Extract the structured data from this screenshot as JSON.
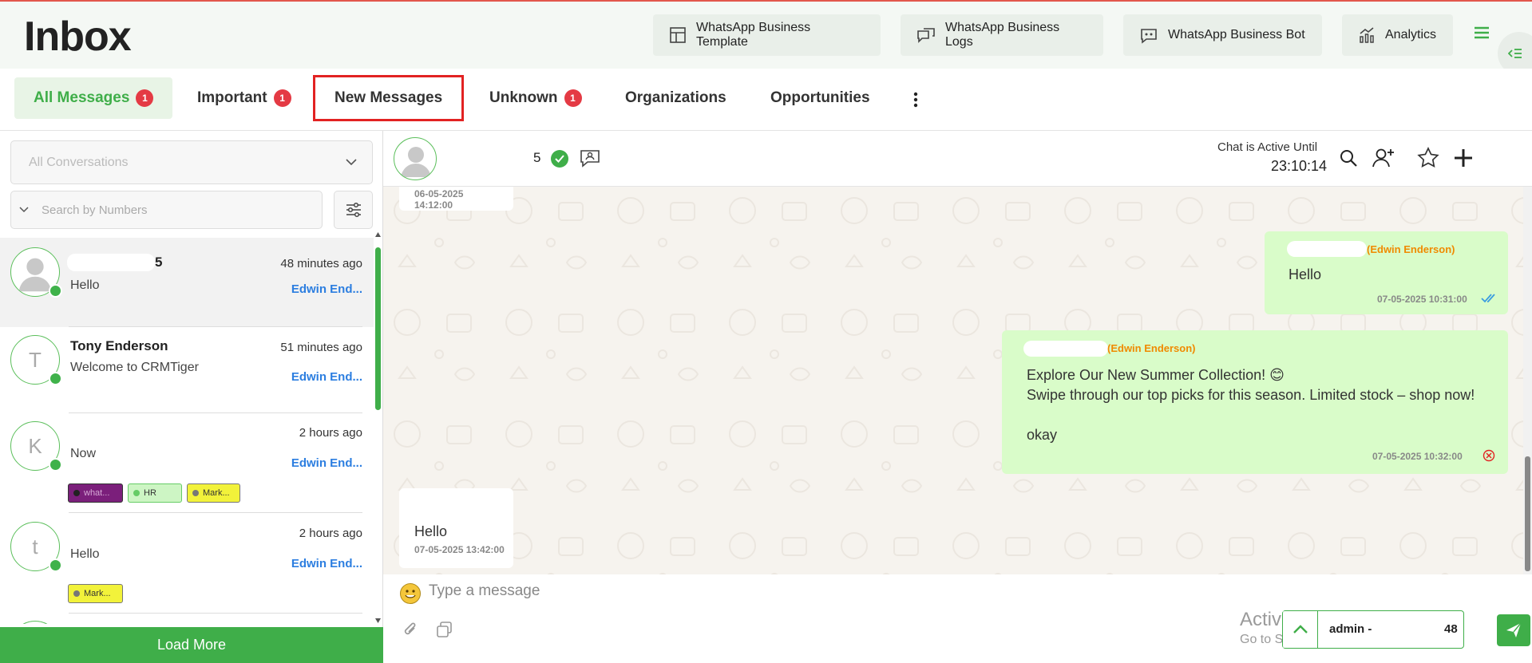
{
  "header": {
    "title": "Inbox",
    "buttons": [
      {
        "label": "WhatsApp Business Template",
        "icon": "layout-template-icon"
      },
      {
        "label": "WhatsApp Business Logs",
        "icon": "chat-logs-icon"
      },
      {
        "label": "WhatsApp Business Bot",
        "icon": "bot-icon"
      },
      {
        "label": "Analytics",
        "icon": "analytics-icon"
      }
    ]
  },
  "tabs": [
    {
      "label": "All Messages",
      "badge": "1"
    },
    {
      "label": "Important",
      "badge": "1"
    },
    {
      "label": "New Messages",
      "badge": ""
    },
    {
      "label": "Unknown",
      "badge": "1"
    },
    {
      "label": "Organizations",
      "badge": ""
    },
    {
      "label": "Opportunities",
      "badge": ""
    }
  ],
  "sidebar": {
    "conversation_filter": "All Conversations",
    "search_placeholder": "Search by Numbers",
    "load_more": "Load More",
    "items": [
      {
        "name": "5",
        "time": "48 minutes ago",
        "message": "Hello",
        "agent": "Edwin End...",
        "initial": "",
        "tags": []
      },
      {
        "name": "Tony Enderson",
        "time": "51 minutes ago",
        "message": "Welcome to CRMTiger",
        "agent": "Edwin End...",
        "initial": "T",
        "tags": []
      },
      {
        "name": "",
        "time": "2 hours ago",
        "message": "Now",
        "agent": "Edwin End...",
        "initial": "K",
        "tags": [
          {
            "label": "what...",
            "color": "#7b1f7b"
          },
          {
            "label": "HR",
            "color": "#cdf5c4"
          },
          {
            "label": "Mark...",
            "color": "#f2f23a"
          }
        ]
      },
      {
        "name": "",
        "time": "2 hours ago",
        "message": "Hello",
        "agent": "Edwin End...",
        "initial": "t",
        "tags": [
          {
            "label": "Mark...",
            "color": "#f2f23a"
          }
        ]
      }
    ]
  },
  "chat": {
    "contact_suffix": "5",
    "active_label": "Chat is Active Until",
    "active_time": "23:10:14",
    "messages": [
      {
        "direction": "in",
        "text": "",
        "time": "06-05-2025 14:12:00"
      },
      {
        "direction": "out",
        "sender": "(Edwin Enderson)",
        "text": "Hello",
        "time": "07-05-2025 10:31:00",
        "status": "read"
      },
      {
        "direction": "out",
        "sender": "(Edwin Enderson)",
        "text_lines": [
          "Explore Our New Summer Collection! 😊",
          "Swipe through our top picks for this season. Limited stock – shop now!",
          "",
          "okay"
        ],
        "time": "07-05-2025 10:32:00",
        "status": "failed"
      },
      {
        "direction": "in",
        "text": "Hello",
        "time": "07-05-2025 13:42:00"
      }
    ],
    "composer_placeholder": "Type a message",
    "admin_label": "admin - ",
    "admin_suffix": "48"
  },
  "watermark": {
    "line1": "Activate Windows",
    "line2": "Go to Settings to activate Windows."
  },
  "colors": {
    "brand_green": "#3fae49",
    "badge_red": "#e43a44",
    "agent_blue": "#2c7ee0",
    "sender_orange": "#f08a00",
    "outgoing_bubble": "#d9fcc9",
    "highlight_border": "#e22222"
  }
}
